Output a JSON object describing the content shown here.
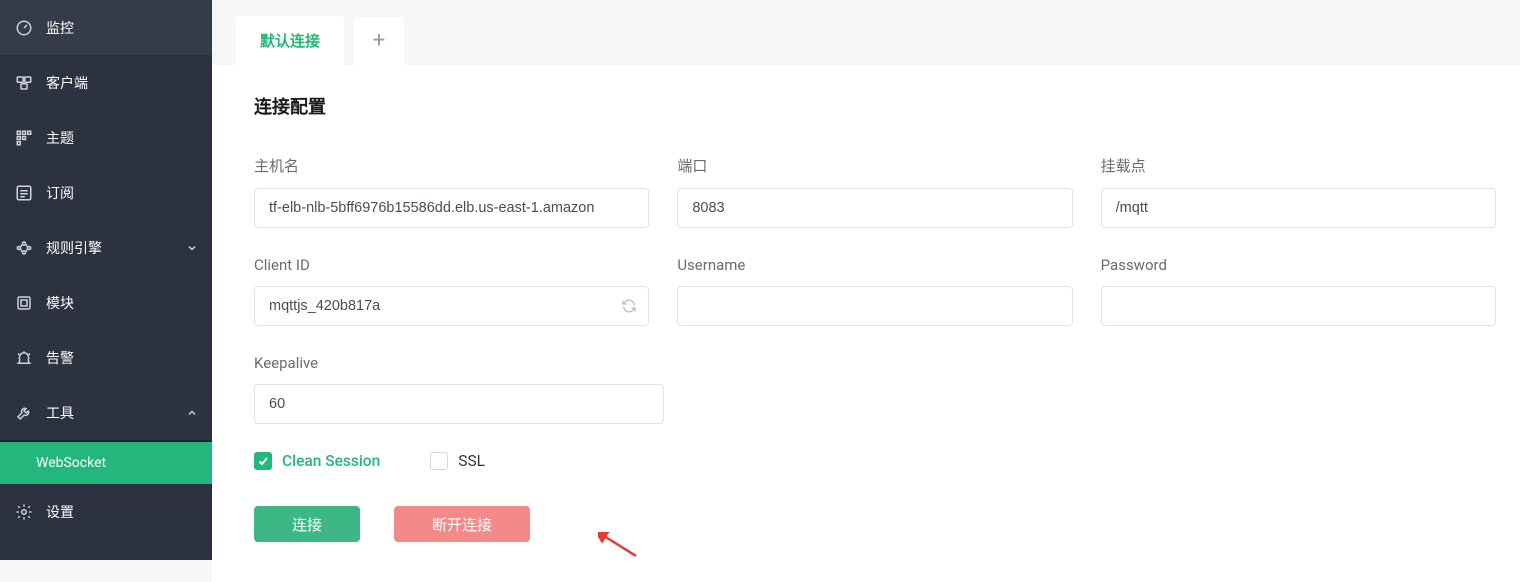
{
  "sidebar": {
    "items": [
      {
        "label": "监控"
      },
      {
        "label": "客户端"
      },
      {
        "label": "主题"
      },
      {
        "label": "订阅"
      },
      {
        "label": "规则引擎",
        "expandable": true
      },
      {
        "label": "模块"
      },
      {
        "label": "告警"
      },
      {
        "label": "工具",
        "expandable": true,
        "expanded": true
      },
      {
        "label": "设置"
      }
    ],
    "sub": {
      "websocket": "WebSocket"
    }
  },
  "tabs": {
    "default_label": "默认连接"
  },
  "section": {
    "title": "连接配置"
  },
  "form": {
    "host": {
      "label": "主机名",
      "value": "tf-elb-nlb-5bff6976b15586dd.elb.us-east-1.amazon"
    },
    "port": {
      "label": "端口",
      "value": "8083"
    },
    "mountpoint": {
      "label": "挂载点",
      "value": "/mqtt"
    },
    "client_id": {
      "label": "Client ID",
      "value": "mqttjs_420b817a"
    },
    "username": {
      "label": "Username",
      "value": ""
    },
    "password": {
      "label": "Password",
      "value": ""
    },
    "keepalive": {
      "label": "Keepalive",
      "value": "60"
    }
  },
  "checks": {
    "clean_session": {
      "label": "Clean Session",
      "checked": true
    },
    "ssl": {
      "label": "SSL",
      "checked": false
    }
  },
  "buttons": {
    "connect": "连接",
    "disconnect": "断开连接"
  }
}
